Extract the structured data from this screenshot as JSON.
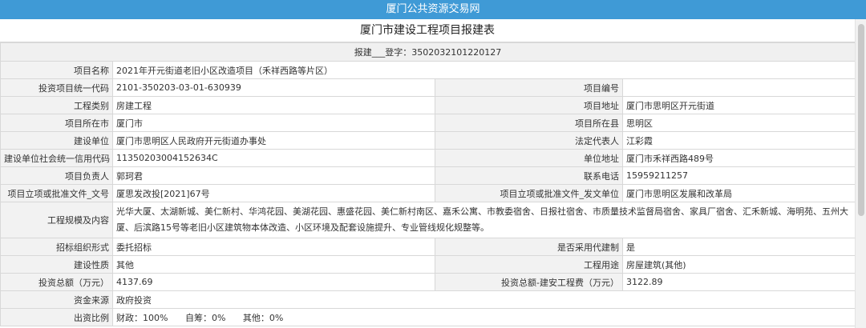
{
  "header": {
    "site_title": "厦门公共资源交易网"
  },
  "document": {
    "title": "厦门市建设工程项目报建表",
    "code_line": "报建___登字：3502032101220127"
  },
  "fields": {
    "project_name": {
      "label": "项目名称",
      "value": "2021年开元街道老旧小区改造项目（禾祥西路等片区）"
    },
    "investment_code": {
      "label": "投资项目统一代码",
      "value": "2101-350203-03-01-630939"
    },
    "project_number": {
      "label": "项目编号",
      "value": ""
    },
    "project_category": {
      "label": "工程类别",
      "value": "房建工程"
    },
    "project_address": {
      "label": "项目地址",
      "value": "厦门市思明区开元街道"
    },
    "project_city": {
      "label": "项目所在市",
      "value": "厦门市"
    },
    "project_county": {
      "label": "项目所在县",
      "value": "思明区"
    },
    "builder_unit": {
      "label": "建设单位",
      "value": "厦门市思明区人民政府开元街道办事处"
    },
    "legal_rep": {
      "label": "法定代表人",
      "value": "江彩霞"
    },
    "credit_code": {
      "label": "建设单位社会统一信用代码",
      "value": "11350203004152634C"
    },
    "unit_address": {
      "label": "单位地址",
      "value": "厦门市禾祥西路489号"
    },
    "project_leader": {
      "label": "项目负责人",
      "value": "郭珂君"
    },
    "contact_phone": {
      "label": "联系电话",
      "value": "15959211257"
    },
    "approval_doc_no": {
      "label": "项目立项或批准文件_文号",
      "value": "厦思发改投[2021]67号"
    },
    "approval_doc_unit": {
      "label": "项目立项或批准文件_发文单位",
      "value": "厦门市思明区发展和改革局"
    },
    "project_scale": {
      "label": "工程规模及内容",
      "value": "光华大厦、太湖新城、美仁新村、华鸿花园、美湖花园、惠盛花园、美仁新村南区、嘉禾公寓、市教委宿舍、日报社宿舍、市质量技术监督局宿舍、家具厂宿舍、汇禾新城、海明苑、五州大厦、后滨路15号等老旧小区建筑物本体改造、小区环境及配套设施提升、专业管线规化规整等。"
    },
    "tender_form": {
      "label": "招标组织形式",
      "value": "委托招标"
    },
    "agent_construction": {
      "label": "是否采用代建制",
      "value": "是"
    },
    "construction_nature": {
      "label": "建设性质",
      "value": "其他"
    },
    "project_use": {
      "label": "工程用途",
      "value": "房屋建筑(其他)"
    },
    "total_investment": {
      "label": "投资总额（万元）",
      "value": "4137.69"
    },
    "construction_cost": {
      "label": "投资总额-建安工程费（万元）",
      "value": "3122.89"
    },
    "fund_source": {
      "label": "资金来源",
      "value": "政府投资"
    },
    "funding_ratio": {
      "label": "出资比例",
      "items": [
        {
          "label": "财政：",
          "value": "100%"
        },
        {
          "label": "自筹：",
          "value": "0%"
        },
        {
          "label": "其他：",
          "value": "0%"
        }
      ]
    }
  },
  "colors": {
    "header_bg": "#3f9ad6",
    "label_bg": "#f2f2f2",
    "border": "#d8d8d8"
  }
}
